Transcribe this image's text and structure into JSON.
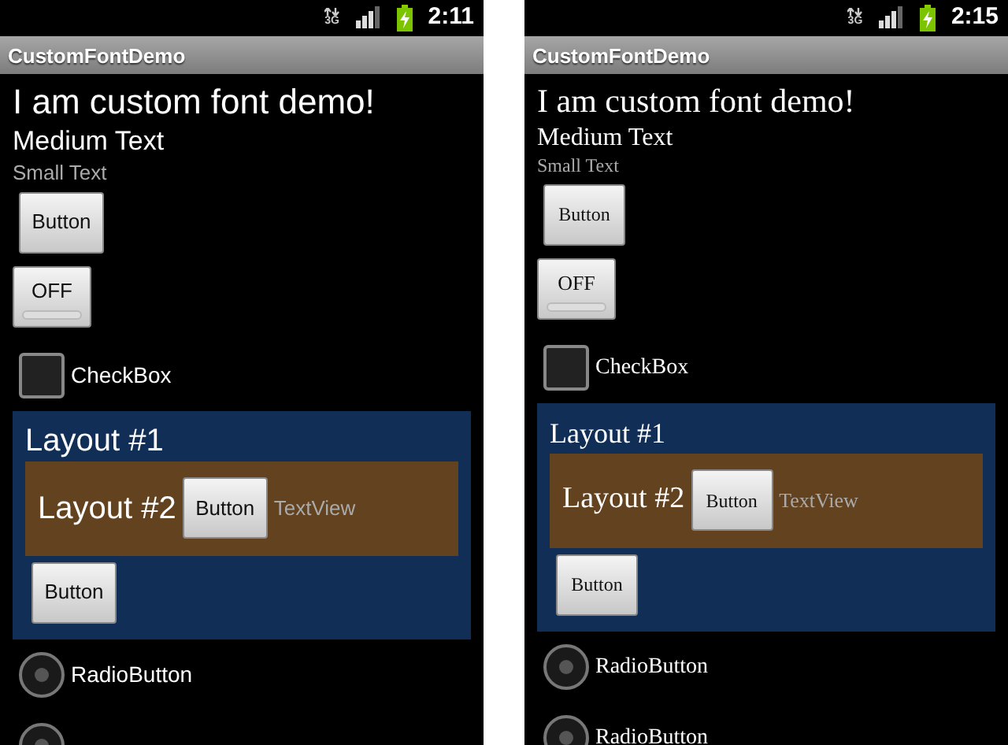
{
  "screens": [
    {
      "kind": "system-font",
      "status_bar": {
        "network": "3G",
        "time": "2:11"
      },
      "title": "CustomFontDemo",
      "heading": "I am custom font demo!",
      "medium_text": "Medium Text",
      "small_text": "Small Text",
      "button": "Button",
      "toggle": {
        "label": "OFF",
        "checked": false
      },
      "checkbox": {
        "label": "CheckBox",
        "checked": false
      },
      "layout_1": {
        "title": "Layout #1",
        "layout_2": {
          "title": "Layout #2",
          "button": "Button",
          "text_view": "TextView"
        },
        "button": "Button"
      },
      "radio_buttons": [
        {
          "label": "RadioButton",
          "selected": false
        },
        {
          "selected": false
        }
      ]
    },
    {
      "kind": "custom-font",
      "status_bar": {
        "network": "3G",
        "time": "2:15"
      },
      "title": "CustomFontDemo",
      "heading": "I am custom font demo!",
      "medium_text": "Medium Text",
      "small_text": "Small Text",
      "button": "Button",
      "toggle": {
        "label": "OFF",
        "checked": false
      },
      "checkbox": {
        "label": "CheckBox",
        "checked": false
      },
      "layout_1": {
        "title": "Layout #1",
        "layout_2": {
          "title": "Layout #2",
          "button": "Button",
          "text_view": "TextView"
        },
        "button": "Button"
      },
      "radio_buttons": [
        {
          "label": "RadioButton",
          "selected": false
        },
        {
          "label": "RadioButton",
          "selected": false
        }
      ]
    }
  ]
}
